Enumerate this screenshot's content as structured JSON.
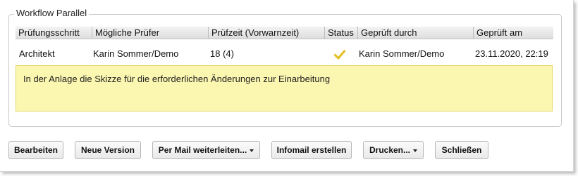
{
  "fieldset": {
    "legend": "Workflow Parallel"
  },
  "table": {
    "columns": [
      "Prüfungsschritt",
      "Mögliche Prüfer",
      "Prüfzeit (Vorwarnzeit)",
      "Status",
      "Geprüft durch",
      "Geprüft am"
    ],
    "rows": [
      {
        "step": "Architekt",
        "reviewers": "Karin Sommer/Demo",
        "time": "18 (4)",
        "status_icon": "checkmark-icon",
        "status_color": "#e3c02a",
        "checked_by": "Karin Sommer/Demo",
        "checked_at": "23.11.2020, 22:19"
      }
    ],
    "note": "In der Anlage die Skizze für die erforderlichen Änderungen zur Einarbeitung"
  },
  "buttons": {
    "edit": "Bearbeiten",
    "new_version": "Neue Version",
    "forward_mail": "Per Mail weiterleiten...",
    "infomail": "Infomail erstellen",
    "print": "Drucken...",
    "close": "Schließen"
  },
  "colors": {
    "note_background": "#fbf7b0",
    "note_border": "#e6d86a"
  }
}
